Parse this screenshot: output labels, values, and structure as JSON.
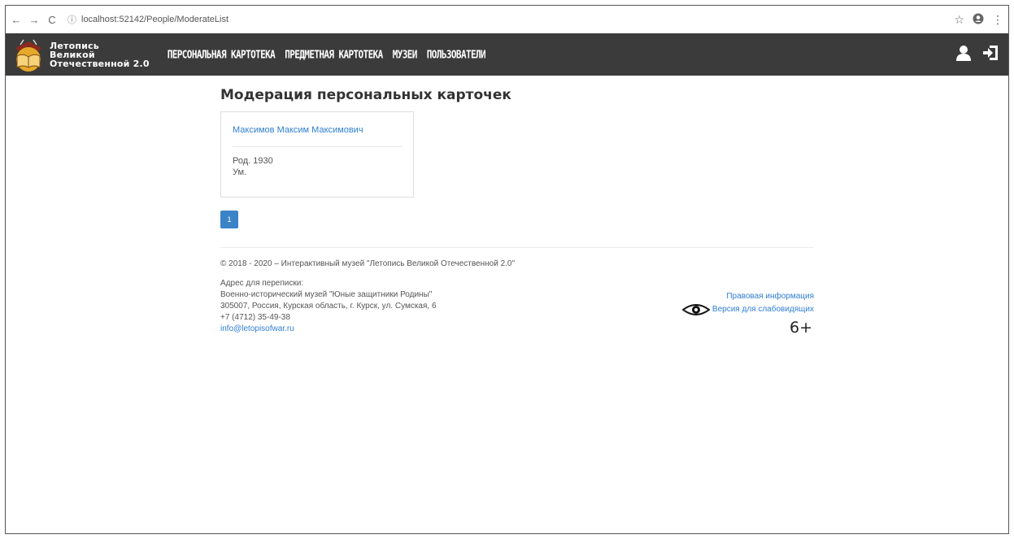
{
  "browser": {
    "url": "localhost:52142/People/ModerateList"
  },
  "logo": {
    "line1": "Летопись",
    "line2": "Великой",
    "line3": "Отечественной 2.0"
  },
  "menu": [
    {
      "label": "ПЕРСОНАЛЬНАЯ КАРТОТЕКА"
    },
    {
      "label": "ПРЕДМЕТНАЯ КАРТОТЕКА"
    },
    {
      "label": "МУЗЕИ"
    },
    {
      "label": "ПОЛЬЗОВАТЕЛИ"
    }
  ],
  "page": {
    "title": "Модерация персональных карточек"
  },
  "cards": [
    {
      "name": "Максимов Максим Максимович",
      "born": "Род. 1930",
      "died": "Ум."
    }
  ],
  "pagination": {
    "pages": [
      "1"
    ],
    "current": "1"
  },
  "footer": {
    "copyright": "© 2018 - 2020 – Интерактивный музей \"Летопись Великой Отечественной 2.0\"",
    "address_label": "Адрес для переписки:",
    "museum": "Военно-исторический музей \"Юные защитники Родины\"",
    "address": "305007, Россия, Курская область, г. Курск, ул. Сумская, 6",
    "phone": "+7 (4712) 35-49-38",
    "email": "info@letopisofwar.ru",
    "legal_link": "Правовая информация",
    "vision_link": "Версия для слабовидящих",
    "age_rating": "6+"
  }
}
